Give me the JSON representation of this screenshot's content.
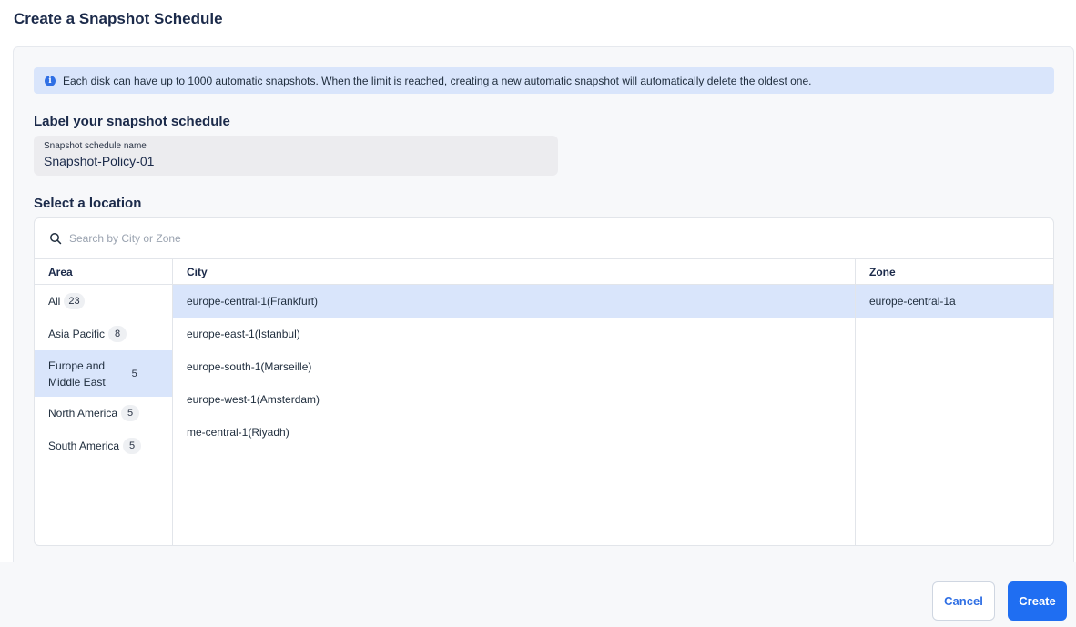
{
  "page": {
    "title": "Create a Snapshot Schedule"
  },
  "notice": {
    "icon": "info-icon",
    "text": "Each disk can have up to 1000 automatic snapshots. When the limit is reached, creating a new automatic snapshot will automatically delete the oldest one."
  },
  "label_section": {
    "heading": "Label your snapshot schedule",
    "field_label": "Snapshot schedule name",
    "field_value": "Snapshot-Policy-01"
  },
  "location_section": {
    "heading": "Select a location",
    "search_placeholder": "Search by City or Zone",
    "columns": {
      "area": "Area",
      "city": "City",
      "zone": "Zone"
    },
    "areas": [
      {
        "label": "All",
        "count": "23"
      },
      {
        "label": "Asia Pacific",
        "count": "8"
      },
      {
        "label_line1": "Europe and",
        "label_line2": "Middle East",
        "count": "5",
        "selected": true
      },
      {
        "label": "North America",
        "count": "5"
      },
      {
        "label": "South America",
        "count": "5"
      }
    ],
    "cities": [
      "europe-central-1(Frankfurt)",
      "europe-east-1(Istanbul)",
      "europe-south-1(Marseille)",
      "europe-west-1(Amsterdam)",
      "me-central-1(Riyadh)"
    ],
    "zones": [
      "europe-central-1a"
    ]
  },
  "footer": {
    "cancel_label": "Cancel",
    "create_label": "Create"
  },
  "colors": {
    "accent": "#1f6ef2",
    "selected_bg": "#d9e5fb"
  }
}
